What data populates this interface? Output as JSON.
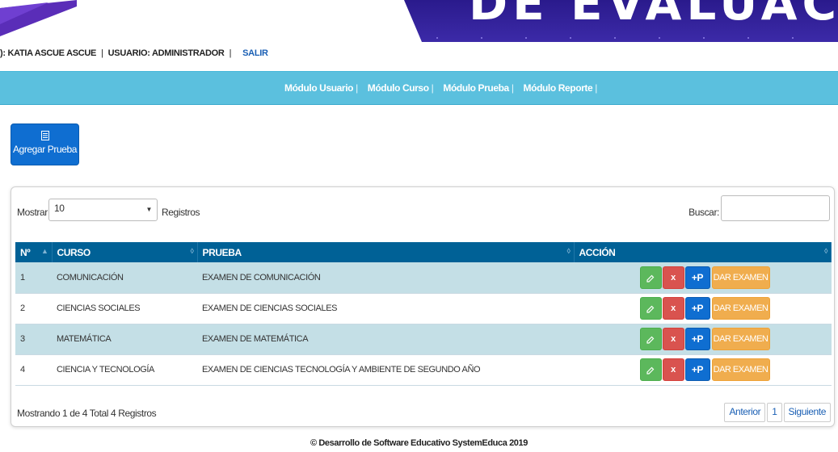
{
  "header": {
    "banner_title": "DE EVALUACIÓN"
  },
  "userbar": {
    "name_text": "): KATIA ASCUE ASCUE",
    "user_text": "USUARIO: ADMINISTRADOR",
    "logout_label": "SALIR"
  },
  "nav": {
    "items": [
      {
        "label": "Módulo Usuario"
      },
      {
        "label": "Módulo Curso"
      },
      {
        "label": "Módulo Prueba"
      },
      {
        "label": "Módulo Reporte"
      }
    ],
    "divider": "|"
  },
  "toolbar": {
    "add_label": "Agregar Prueba"
  },
  "table_controls": {
    "show_label": "Mostrar",
    "page_size": "10",
    "records_label": "Registros",
    "search_label": "Buscar:",
    "search_value": ""
  },
  "table": {
    "columns": [
      "Nº",
      "CURSO",
      "PRUEBA",
      "ACCIÓN"
    ],
    "rows": [
      {
        "n": "1",
        "curso": "COMUNICACIÓN",
        "prueba": "EXAMEN DE COMUNICACIÓN"
      },
      {
        "n": "2",
        "curso": "CIENCIAS SOCIALES",
        "prueba": "EXAMEN DE CIENCIAS SOCIALES"
      },
      {
        "n": "3",
        "curso": "MATEMÁTICA",
        "prueba": "EXAMEN DE MATEMÁTICA"
      },
      {
        "n": "4",
        "curso": "CIENCIA Y TECNOLOGÍA",
        "prueba": "EXAMEN DE CIENCIAS TECNOLOGÍA Y AMBIENTE DE SEGUNDO AÑO"
      }
    ],
    "actions": {
      "delete_label": "x",
      "add_question_label": "+P",
      "exam_label": "DAR EXAMEN"
    }
  },
  "table_footer": {
    "info": "Mostrando 1 de 4 Total 4 Registros",
    "prev_label": "Anterior",
    "page_label": "1",
    "next_label": "Siguiente"
  },
  "footer": {
    "text": "© Desarrollo de Software Educativo SystemEduca 2019"
  },
  "colors": {
    "nav_bg": "#5bc0de",
    "table_header_bg": "#006196",
    "odd_row_bg": "#c4dfe6",
    "primary_button": "#0f6ed1",
    "edit_button": "#5cb85c",
    "delete_button": "#d9534f",
    "exam_button": "#f0ad4e",
    "banner_purple": "#3b1f9e"
  },
  "icons": {
    "add_button_icon": "document-icon",
    "edit_icon": "edit-icon",
    "sort_icon": "sort-icon"
  }
}
